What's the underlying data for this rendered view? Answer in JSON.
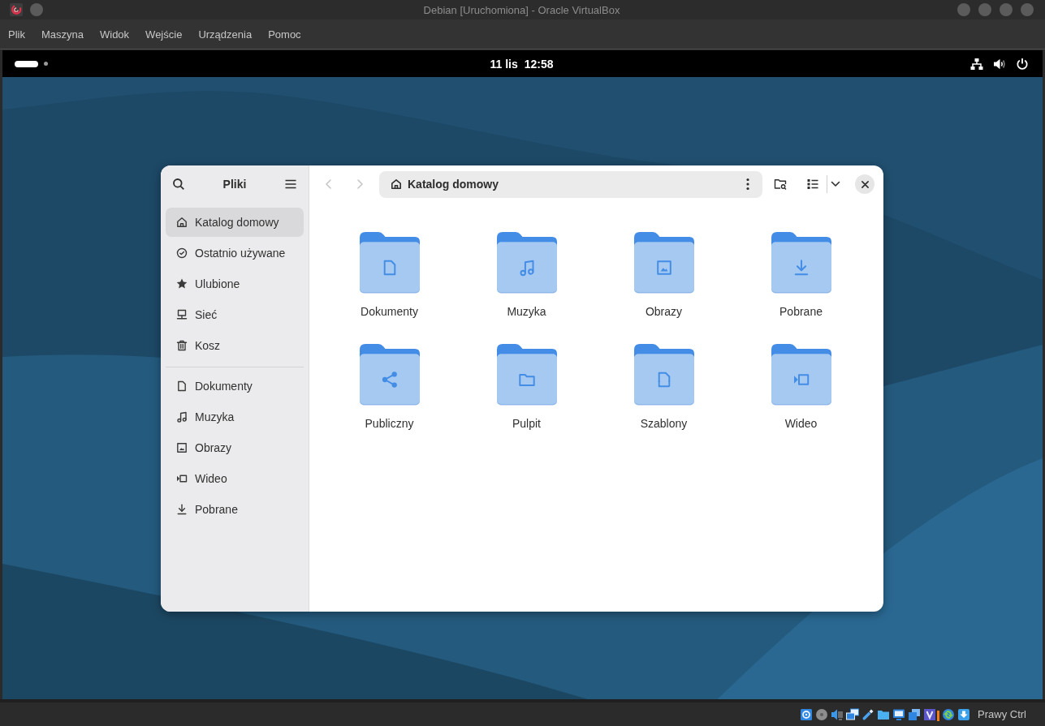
{
  "window": {
    "title": "Debian [Uruchomiona] - Oracle VirtualBox"
  },
  "menu_bar": [
    {
      "label": "Plik"
    },
    {
      "label": "Maszyna"
    },
    {
      "label": "Widok"
    },
    {
      "label": "Wejście"
    },
    {
      "label": "Urządzenia"
    },
    {
      "label": "Pomoc"
    }
  ],
  "guest": {
    "top_bar": {
      "workspaces": [
        {
          "selected": true
        },
        {
          "selected": false
        }
      ],
      "date": "11 lis",
      "time": "12:58"
    },
    "files": {
      "title": "Pliki",
      "sidebar": {
        "places": [
          {
            "label": "Katalog domowy",
            "kind": "home",
            "selected": true
          },
          {
            "label": "Ostatnio używane",
            "kind": "recent",
            "selected": false
          },
          {
            "label": "Ulubione",
            "kind": "starred",
            "selected": false
          },
          {
            "label": "Sieć",
            "kind": "network",
            "selected": false
          },
          {
            "label": "Kosz",
            "kind": "trash",
            "selected": false
          }
        ],
        "bookmarks": [
          {
            "label": "Dokumenty",
            "kind": "documents",
            "selected": false
          },
          {
            "label": "Muzyka",
            "kind": "music",
            "selected": false
          },
          {
            "label": "Obrazy",
            "kind": "pictures",
            "selected": false
          },
          {
            "label": "Wideo",
            "kind": "videos",
            "selected": false
          },
          {
            "label": "Pobrane",
            "kind": "downloads",
            "selected": false
          }
        ]
      },
      "navigation": [
        {
          "kind": "back",
          "disabled": true
        },
        {
          "kind": "forward",
          "disabled": true
        }
      ],
      "path": {
        "kind": "home",
        "label": "Katalog domowy"
      },
      "folders": [
        {
          "name": "Dokumenty",
          "kind": "documents",
          "selected": false
        },
        {
          "name": "Muzyka",
          "kind": "music",
          "selected": false
        },
        {
          "name": "Obrazy",
          "kind": "pictures",
          "selected": false
        },
        {
          "name": "Pobrane",
          "kind": "downloads",
          "selected": false
        },
        {
          "name": "Publiczny",
          "kind": "public",
          "selected": false
        },
        {
          "name": "Pulpit",
          "kind": "desktop",
          "selected": false
        },
        {
          "name": "Szablony",
          "kind": "templates",
          "selected": false
        },
        {
          "name": "Wideo",
          "kind": "videos",
          "selected": false
        }
      ]
    }
  },
  "status_bar": {
    "host_key": "Prawy Ctrl"
  }
}
